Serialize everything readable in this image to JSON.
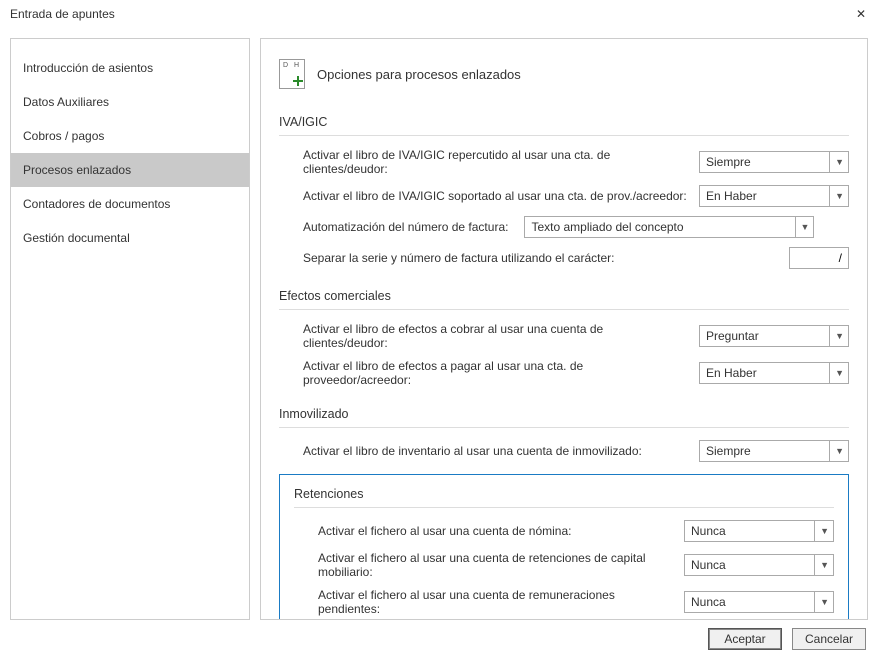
{
  "window": {
    "title": "Entrada de apuntes"
  },
  "sidebar": {
    "items": [
      {
        "label": "Introducción de asientos"
      },
      {
        "label": "Datos Auxiliares"
      },
      {
        "label": "Cobros / pagos"
      },
      {
        "label": "Procesos enlazados"
      },
      {
        "label": "Contadores de documentos"
      },
      {
        "label": "Gestión documental"
      }
    ],
    "selected_index": 3
  },
  "page": {
    "title": "Opciones para procesos enlazados"
  },
  "sections": {
    "iva": {
      "title": "IVA/IGIC",
      "repercutido_label": "Activar el libro de IVA/IGIC repercutido al usar una cta. de clientes/deudor:",
      "repercutido_value": "Siempre",
      "soportado_label": "Activar el libro de IVA/IGIC soportado al usar una cta. de prov./acreedor:",
      "soportado_value": "En Haber",
      "auto_num_label": "Automatización del número de factura:",
      "auto_num_value": "Texto ampliado del concepto",
      "sep_label": "Separar la serie y número de factura utilizando el carácter:",
      "sep_value": "/"
    },
    "efectos": {
      "title": "Efectos comerciales",
      "cobrar_label": "Activar el libro de efectos a cobrar al usar una cuenta de clientes/deudor:",
      "cobrar_value": "Preguntar",
      "pagar_label": "Activar el libro de efectos a pagar al usar una cta. de proveedor/acreedor:",
      "pagar_value": "En Haber"
    },
    "inmovilizado": {
      "title": "Inmovilizado",
      "inv_label": "Activar el libro de inventario al usar una cuenta de inmovilizado:",
      "inv_value": "Siempre"
    },
    "retenciones": {
      "title": "Retenciones",
      "nomina_label": "Activar el fichero al usar una cuenta de nómina:",
      "nomina_value": "Nunca",
      "capital_label": "Activar el fichero al usar una cuenta de retenciones de capital mobiliario:",
      "capital_value": "Nunca",
      "remun_label": "Activar el fichero al usar una cuenta de remuneraciones pendientes:",
      "remun_value": "Nunca"
    }
  },
  "buttons": {
    "accept": "Aceptar",
    "cancel": "Cancelar"
  }
}
